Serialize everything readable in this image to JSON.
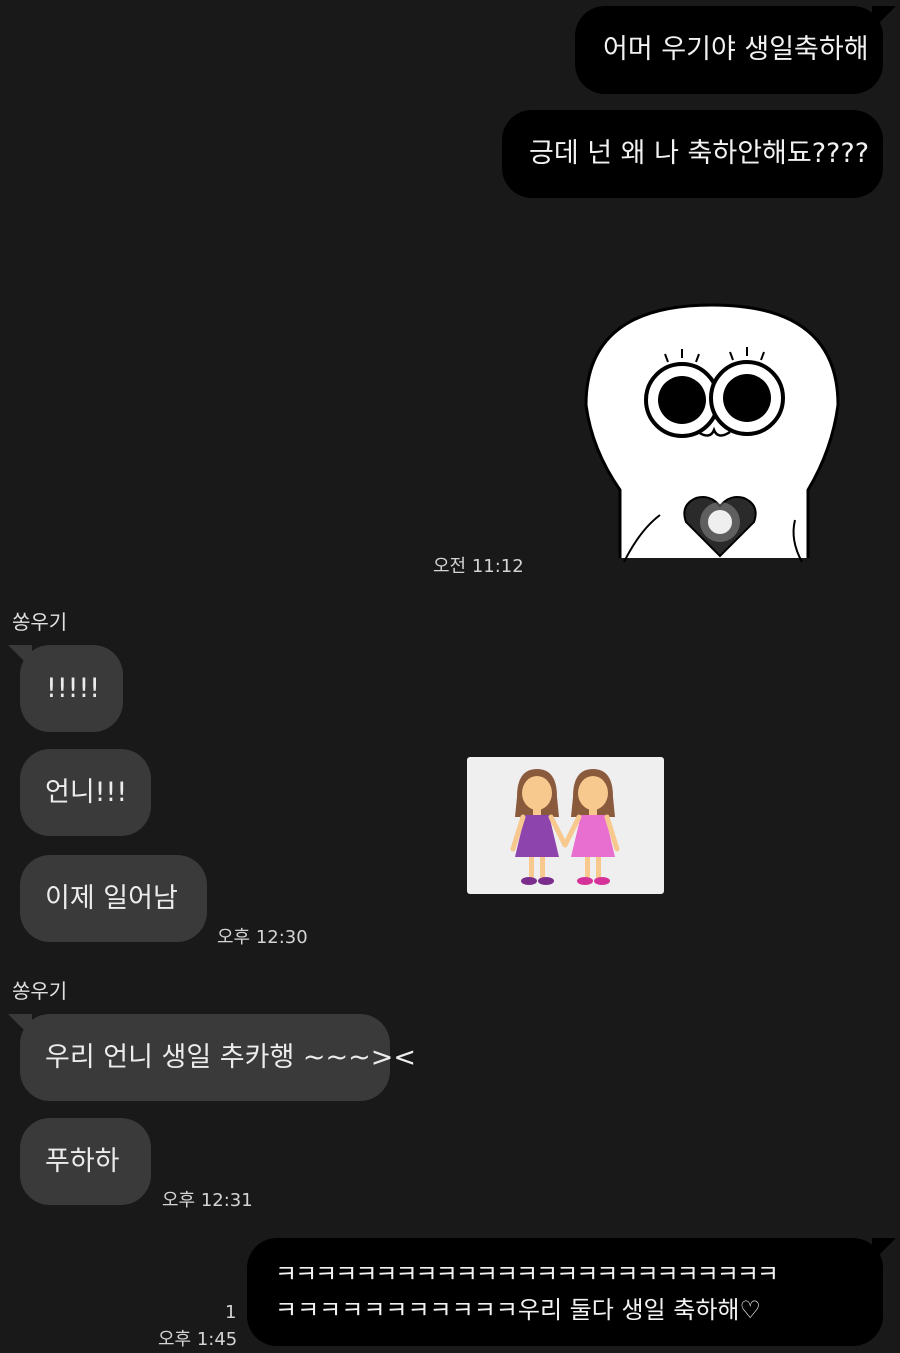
{
  "messages": {
    "sent_1": "어머 우기야 생일축하해",
    "sent_2": "긍데 넌 왜 나 축하안해됴????",
    "time_sent_sticker": "오전 11:12",
    "sender_1": "쏭우기",
    "recv_1": "!!!!!",
    "recv_2": "언니!!!",
    "recv_3": "이제 일어남",
    "time_recv_1": "오후 12:30",
    "sender_2": "쏭우기",
    "recv_4": "우리 언니 생일 추카행 ~~~><",
    "recv_5": "푸하하",
    "time_recv_2": "오후 12:31",
    "sent_3_line1": "ㅋㅋㅋㅋㅋㅋㅋㅋㅋㅋㅋㅋㅋㅋㅋㅋㅋㅋㅋㅋㅋㅋㅋㅋㅋ",
    "sent_3_line2": "ㅋㅋㅋㅋㅋㅋㅋㅋㅋㅋㅋ우리 둘다 생일 축하해♡",
    "unread_count": "1",
    "time_sent_3": "오후 1:45"
  },
  "stickers": {
    "character_sticker": "white-character-with-heart-icon",
    "emoji_sticker": "two-girls-holding-hands-icon"
  },
  "colors": {
    "background": "#191919",
    "sent_bubble": "#000000",
    "received_bubble": "#3a3a3a"
  }
}
